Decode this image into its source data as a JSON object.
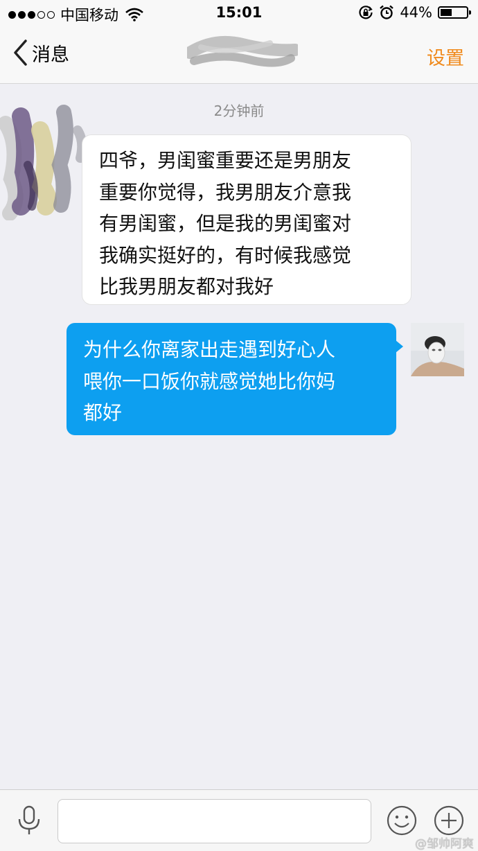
{
  "status_bar": {
    "carrier": "中国移动",
    "time": "15:01",
    "battery_percent": "44%",
    "battery_level": 0.44,
    "signal_bars_filled": 3,
    "signal_bars_total": 5
  },
  "nav": {
    "back_label": "消息",
    "settings_label": "设置"
  },
  "chat": {
    "timestamp": "2分钟前",
    "messages": [
      {
        "direction": "incoming",
        "lines": [
          "四爷，男闺蜜重要还是男朋友",
          "重要你觉得，我男朋友介意我",
          "有男闺蜜，但是我的男闺蜜对",
          "我确实挺好的，有时候我感觉",
          "比我男朋友都对我好"
        ]
      },
      {
        "direction": "outgoing",
        "lines": [
          "为什么你离家出走遇到好心人",
          "喂你一口饭你就感觉她比你妈",
          "都好"
        ]
      }
    ]
  },
  "input": {
    "placeholder": ""
  },
  "watermark": "@邹帅阿爽",
  "colors": {
    "accent_orange": "#f08a1c",
    "outgoing_bubble": "#0d9ff0",
    "background": "#efeff4"
  },
  "icons": [
    "wifi-icon",
    "rotation-lock-icon",
    "alarm-icon",
    "battery-icon",
    "back-chevron-icon",
    "microphone-icon",
    "emoji-icon",
    "plus-icon"
  ]
}
